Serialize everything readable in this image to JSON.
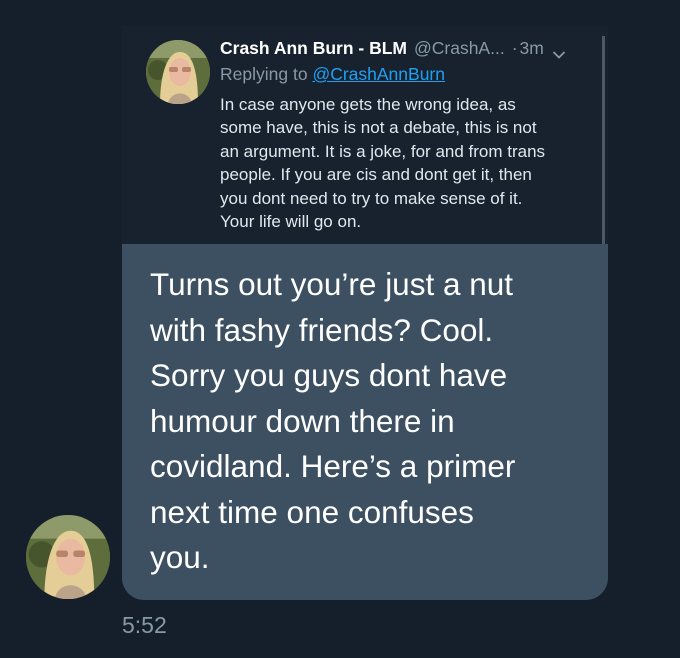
{
  "tweet": {
    "author_name": "Crash Ann Burn - BLM",
    "author_handle": "@CrashA...",
    "separator": "·",
    "time": "3m",
    "reply_prefix": "Replying to",
    "reply_handle": "@CrashAnnBurn",
    "text": "In case anyone gets the wrong idea, as\nsome have, this is not a debate, this is not\nan argument. It is a joke, for and from trans\npeople. If you are cis and dont get it, then\nyou dont need to try to make sense of it.\nYour life will go on."
  },
  "message": {
    "text": "Turns out you’re just a nut\nwith fashy friends? Cool.\nSorry you guys dont have\nhumour down there in\ncovidland. Here’s a primer\nnext time one confuses\nyou.",
    "timestamp": "5:52"
  },
  "icons": {
    "tweet_menu": "chevron-down-icon",
    "avatar": "profile-photo"
  },
  "colors": {
    "background": "#151f2c",
    "bubble": "#3d5061",
    "link": "#1da1f2",
    "muted": "#8899a6"
  }
}
